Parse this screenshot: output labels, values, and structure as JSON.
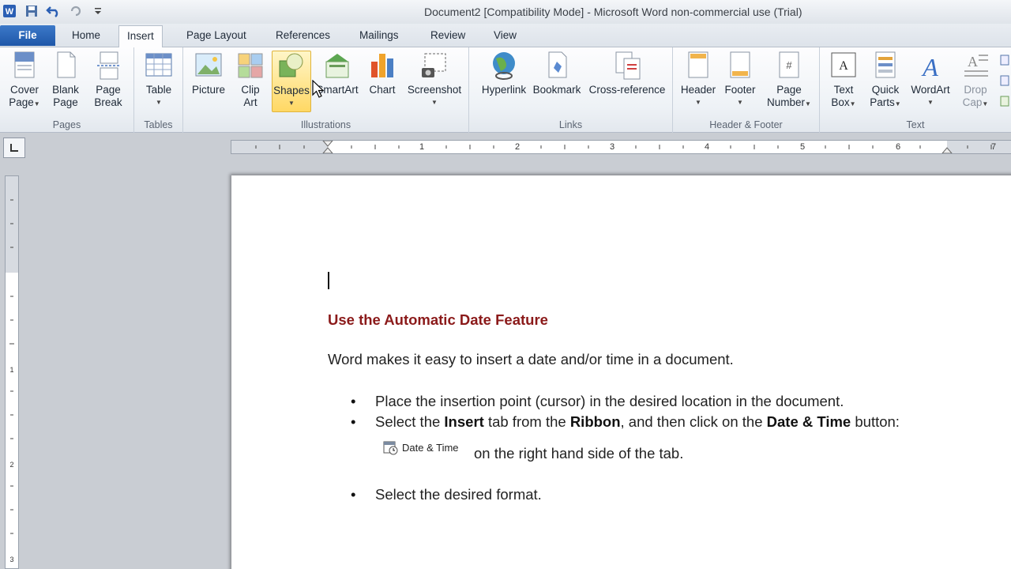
{
  "window": {
    "title": "Document2 [Compatibility Mode] - Microsoft Word non-commercial use (Trial)"
  },
  "tabs": [
    {
      "label": "File"
    },
    {
      "label": "Home"
    },
    {
      "label": "Insert"
    },
    {
      "label": "Page Layout"
    },
    {
      "label": "References"
    },
    {
      "label": "Mailings"
    },
    {
      "label": "Review"
    },
    {
      "label": "View"
    }
  ],
  "ribbon": {
    "groups": {
      "pages": "Pages",
      "tables": "Tables",
      "illustrations": "Illustrations",
      "links": "Links",
      "header_footer": "Header & Footer",
      "text": "Text"
    },
    "buttons": {
      "cover_page": [
        "Cover",
        "Page"
      ],
      "blank_page": [
        "Blank",
        "Page"
      ],
      "page_break": [
        "Page",
        "Break"
      ],
      "table": "Table",
      "picture": "Picture",
      "clip_art": [
        "Clip",
        "Art"
      ],
      "shapes": "Shapes",
      "smartart": "SmartArt",
      "chart": "Chart",
      "screenshot": "Screenshot",
      "hyperlink": "Hyperlink",
      "bookmark": "Bookmark",
      "cross_reference": "Cross-reference",
      "header": "Header",
      "footer": "Footer",
      "page_number": [
        "Page",
        "Number"
      ],
      "text_box": [
        "Text",
        "Box"
      ],
      "quick_parts": [
        "Quick",
        "Parts"
      ],
      "wordart": "WordArt",
      "drop_cap": [
        "Drop",
        "Cap"
      ]
    }
  },
  "ruler": {
    "numbers": [
      "1",
      "1",
      "2",
      "3",
      "4",
      "5",
      "6",
      "7"
    ]
  },
  "document": {
    "heading": "Use the Automatic Date Feature",
    "intro": "Word makes it easy to insert a date and/or time in a document.",
    "bullets": {
      "b1": "Place the insertion point (cursor) in the desired location in the document.",
      "b2_parts": [
        "Select the ",
        "Insert",
        " tab from the ",
        "Ribbon",
        ", and then click on the ",
        "Date & Time",
        " button:"
      ],
      "date_time_label": "Date & Time",
      "b2_tail": "on the right hand side of the tab.",
      "b3": "Select the desired format."
    }
  },
  "colors": {
    "heading": "#8b1a1a",
    "file_tab": "#2b63b5",
    "active_button": "#ffd864"
  }
}
